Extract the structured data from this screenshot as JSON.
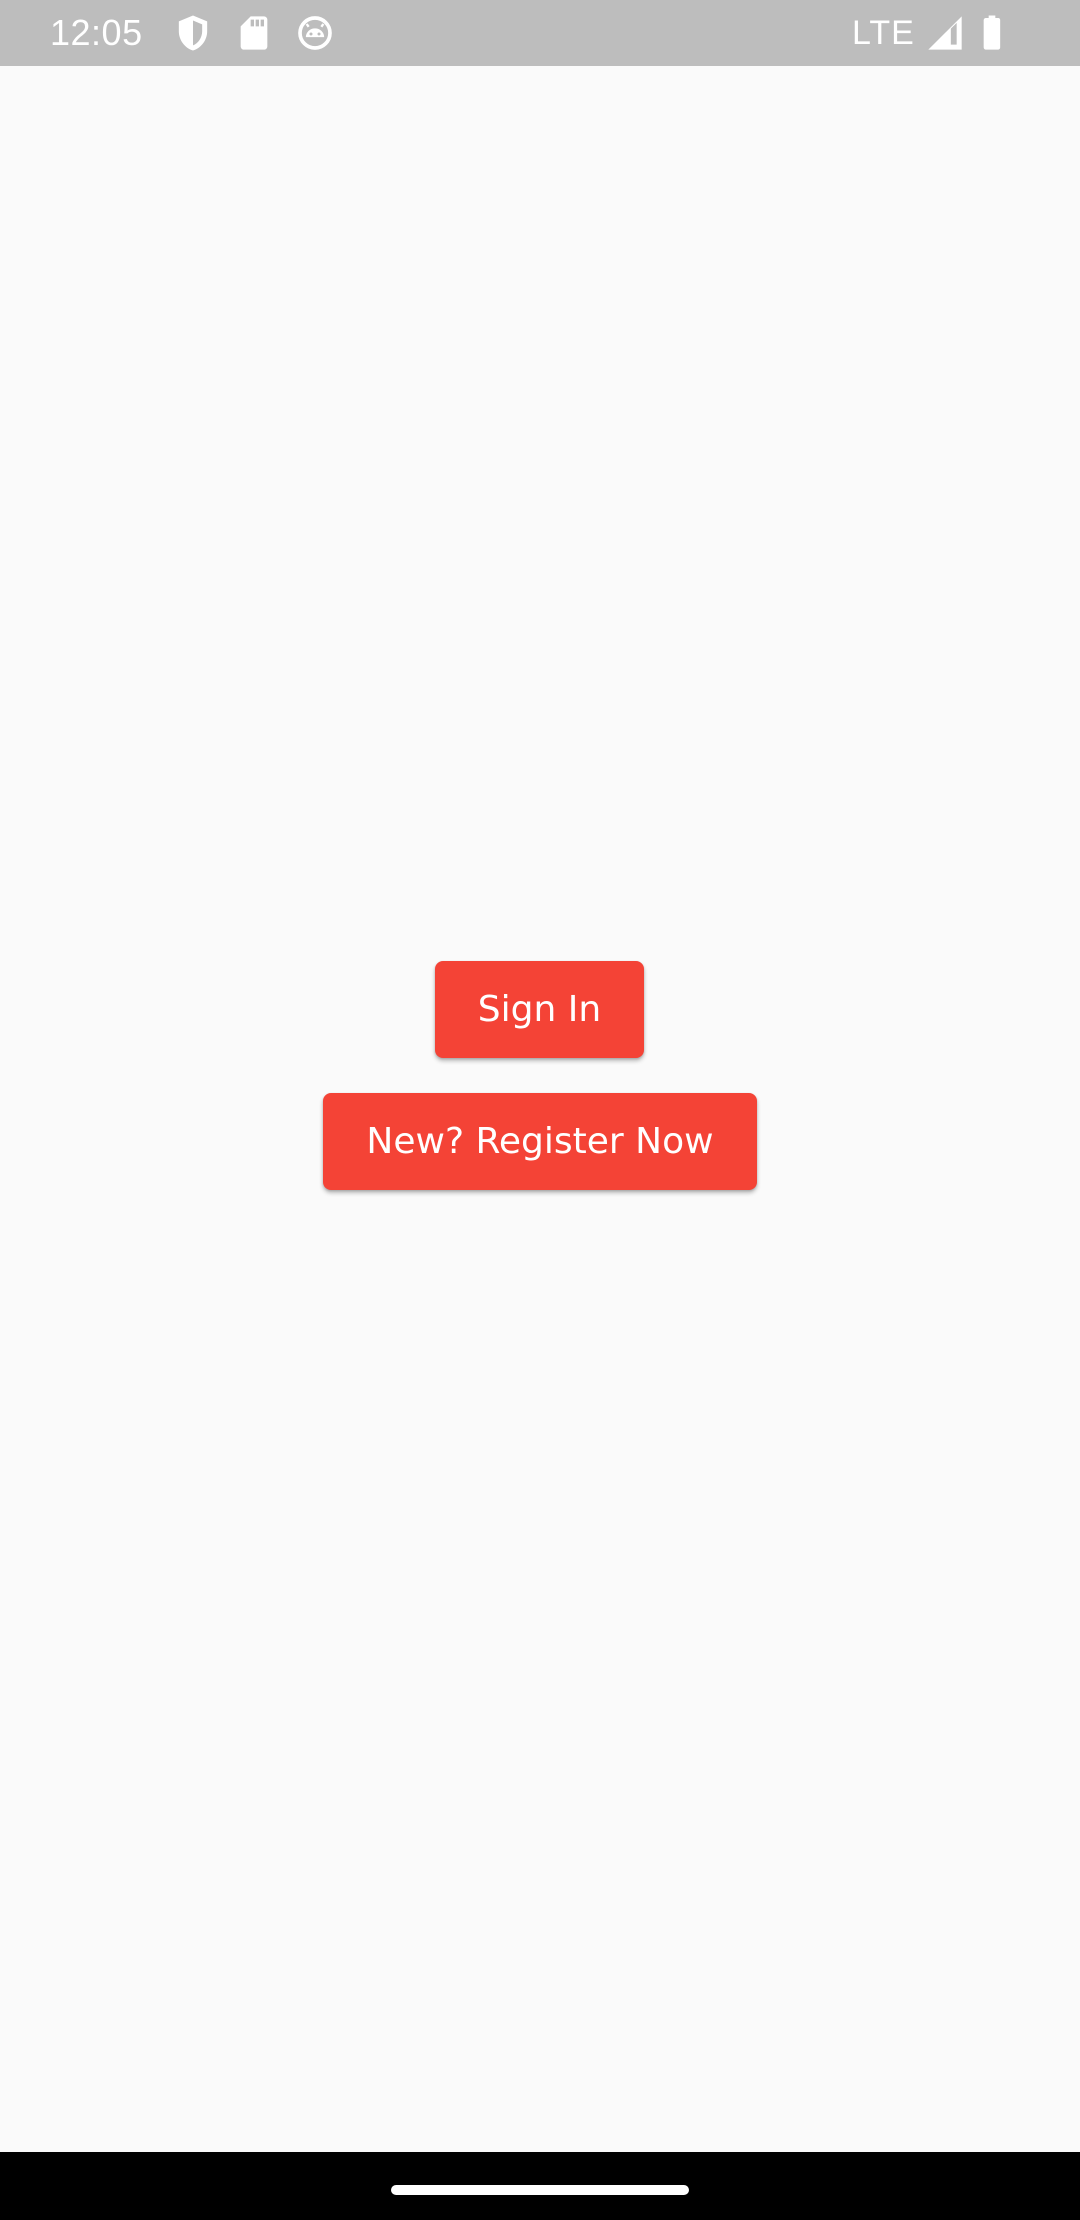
{
  "status_bar": {
    "time": "12:05",
    "network_label": "LTE",
    "icons": [
      "shield-icon",
      "sd-card-icon",
      "android-head-icon",
      "signal-icon",
      "battery-icon"
    ],
    "background_color": "#bdbdbd"
  },
  "main": {
    "signin_label": "Sign In",
    "register_label": "New? Register Now",
    "button_color": "#f44336",
    "background_color": "#fafafa"
  },
  "nav_bar": {
    "background_color": "#000000"
  }
}
